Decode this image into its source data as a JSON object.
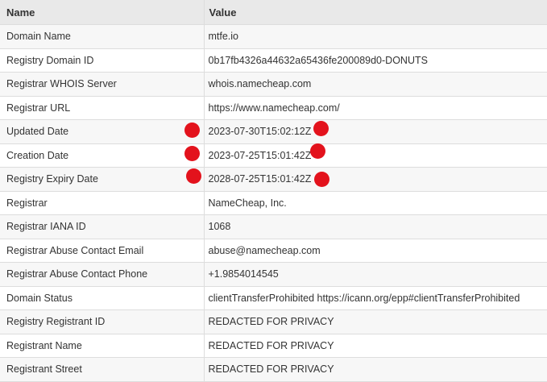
{
  "table": {
    "headers": [
      "Name",
      "Value"
    ],
    "rows": [
      {
        "name": "Domain Name",
        "value": "mtfe.io"
      },
      {
        "name": "Registry Domain ID",
        "value": "0b17fb4326a44632a65436fe200089d0-DONUTS"
      },
      {
        "name": "Registrar WHOIS Server",
        "value": "whois.namecheap.com"
      },
      {
        "name": "Registrar URL",
        "value": "https://www.namecheap.com/"
      },
      {
        "name": "Updated Date",
        "value": "2023-07-30T15:02:12Z"
      },
      {
        "name": "Creation Date",
        "value": "2023-07-25T15:01:42Z"
      },
      {
        "name": "Registry Expiry Date",
        "value": "2028-07-25T15:01:42Z"
      },
      {
        "name": "Registrar",
        "value": "NameCheap, Inc."
      },
      {
        "name": "Registrar IANA ID",
        "value": "1068"
      },
      {
        "name": "Registrar Abuse Contact Email",
        "value": "abuse@namecheap.com"
      },
      {
        "name": "Registrar Abuse Contact Phone",
        "value": "+1.9854014545"
      },
      {
        "name": "Domain Status",
        "value": "clientTransferProhibited https://icann.org/epp#clientTransferProhibited"
      },
      {
        "name": "Registry Registrant ID",
        "value": "REDACTED FOR PRIVACY"
      },
      {
        "name": "Registrant Name",
        "value": "REDACTED FOR PRIVACY"
      },
      {
        "name": "Registrant Street",
        "value": "REDACTED FOR PRIVACY"
      }
    ]
  },
  "marker_color": "#e3121c"
}
